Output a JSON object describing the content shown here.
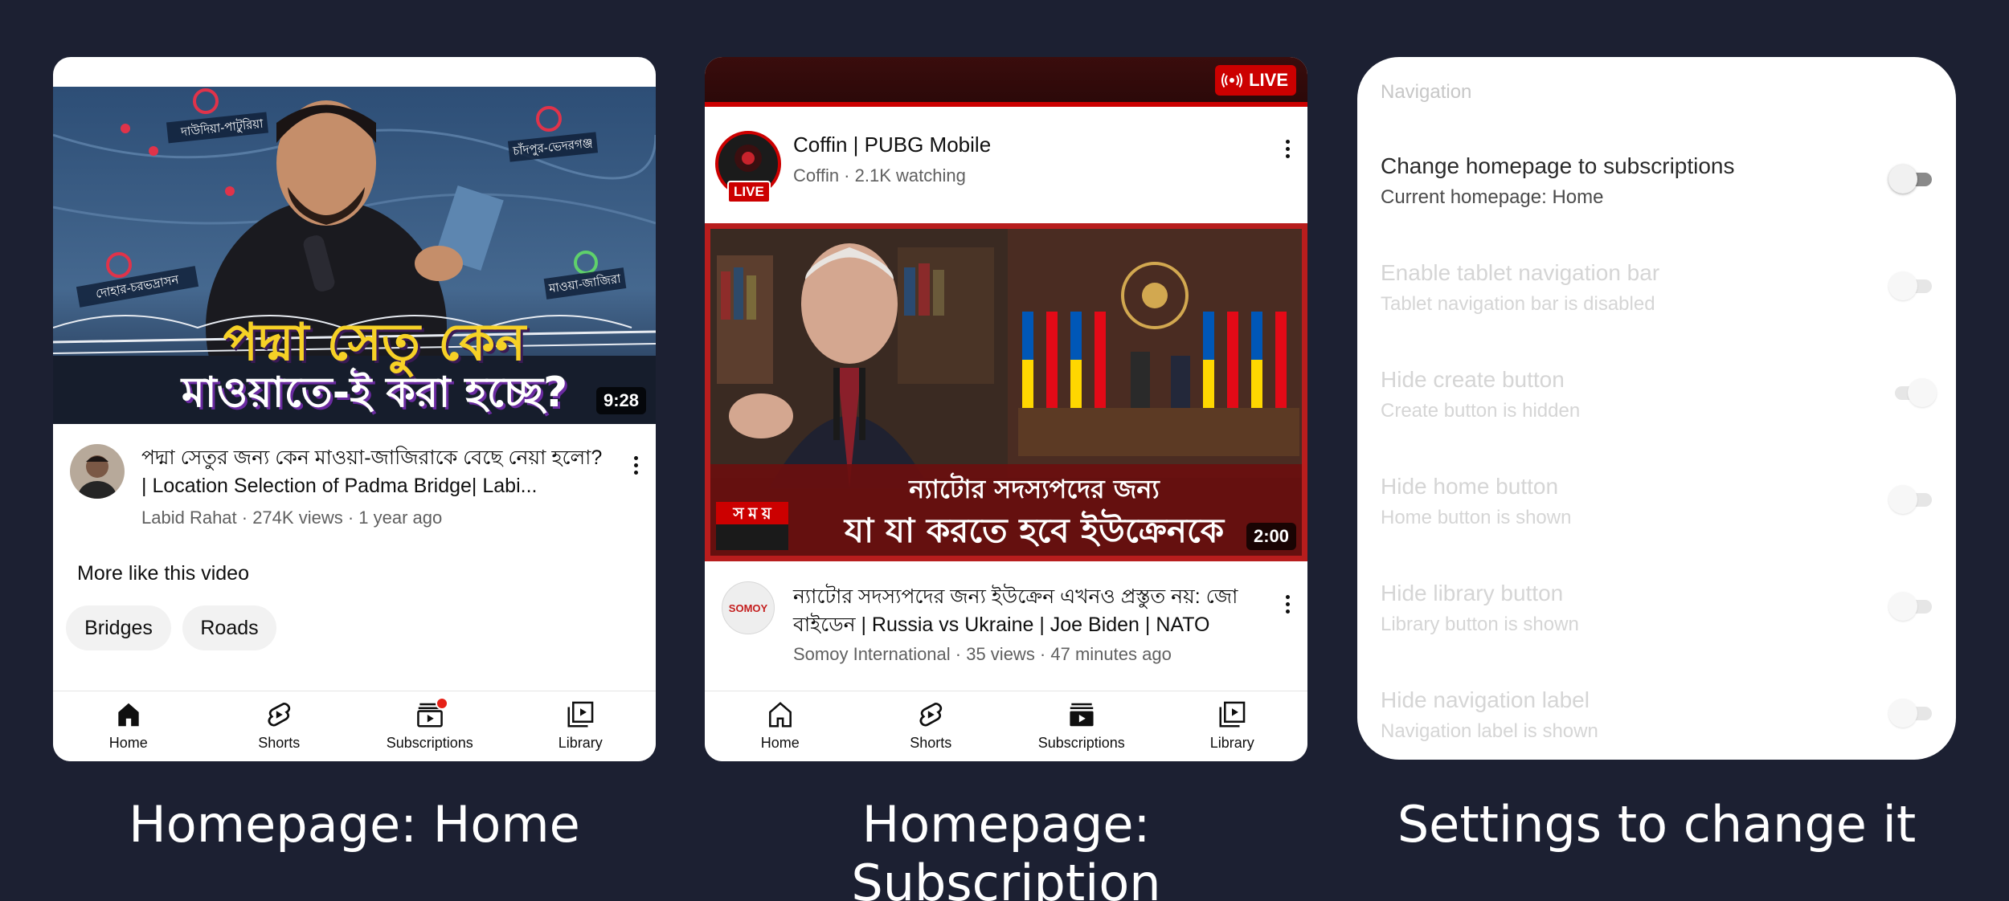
{
  "panel_home": {
    "video": {
      "thumbnail_headline_1": "পদ্মা সেতু কেন",
      "thumbnail_headline_2": "মাওয়াতে-ই করা হচ্ছে?",
      "map_labels": [
        "দাউদিয়া-পাটুরিয়া",
        "চাঁদপুর-ভেদরগঞ্জ",
        "দোহার-চরভদ্রাসন",
        "মাওয়া-জাজিরা"
      ],
      "duration": "9:28",
      "title": "পদ্মা সেতুর জন্য কেন মাওয়া-জাজিরাকে বেছে নেয়া হলো? | Location Selection of Padma Bridge| Labi...",
      "meta": "Labid Rahat · 274K views · 1 year ago"
    },
    "more_heading": "More like this video",
    "chips": [
      "Bridges",
      "Roads"
    ]
  },
  "panel_subs": {
    "live_badge": "LIVE",
    "live_channel": {
      "title": "Coffin | PUBG Mobile",
      "meta": "Coffin · 2.1K watching",
      "avatar_badge": "LIVE"
    },
    "video": {
      "overlay_line_1": "ন্যাটোর সদস্যপদের জন্য",
      "overlay_line_2": "যা যা করতে হবে ইউক্রেনকে",
      "channel_logo_text": "স ম য়",
      "duration": "2:00",
      "title": "ন্যাটোর সদস্যপদের জন্য ইউক্রেন এখনও প্রস্তুত নয়: জো বাইডেন | Russia vs Ukraine | Joe Biden | NATO",
      "meta": "Somoy International · 35 views · 47 minutes ago",
      "avatar_text": "SOMOY"
    }
  },
  "nav": {
    "items": [
      "Home",
      "Shorts",
      "Subscriptions",
      "Library"
    ],
    "notification_color": "#e62117"
  },
  "settings": {
    "header": "Navigation",
    "rows": [
      {
        "title": "Change homepage to subscriptions",
        "subtitle": "Current homepage: Home",
        "enabled": false,
        "active": true
      },
      {
        "title": "Enable tablet navigation bar",
        "subtitle": "Tablet navigation bar is disabled",
        "enabled": false,
        "active": false
      },
      {
        "title": "Hide create button",
        "subtitle": "Create button is hidden",
        "enabled": true,
        "active": false
      },
      {
        "title": "Hide home button",
        "subtitle": "Home button is shown",
        "enabled": false,
        "active": false
      },
      {
        "title": "Hide library button",
        "subtitle": "Library button is shown",
        "enabled": false,
        "active": false
      },
      {
        "title": "Hide navigation label",
        "subtitle": "Navigation label is shown",
        "enabled": false,
        "active": false
      }
    ]
  },
  "captions": [
    "Homepage: Home",
    "Homepage: Subscription",
    "Settings to change it"
  ],
  "colors": {
    "background": "#1c2032",
    "live_red": "#cc0000",
    "headline_yellow": "#f6d126",
    "toggle_on": "#a6b9f4"
  }
}
